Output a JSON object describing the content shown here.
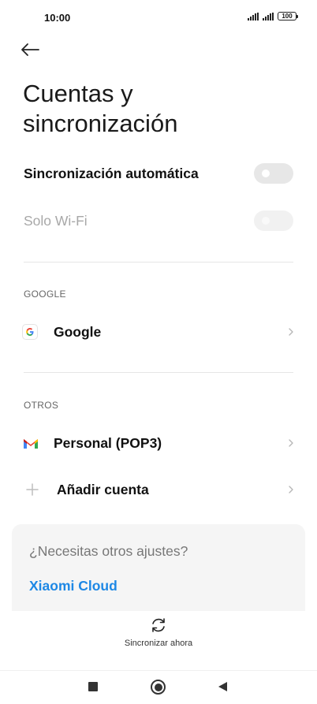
{
  "status_bar": {
    "time": "10:00",
    "battery": "100",
    "icons": [
      "signal-icon",
      "signal-icon",
      "battery-icon"
    ]
  },
  "header": {
    "back_icon": "arrow-left-icon",
    "title": "Cuentas y sincronización"
  },
  "settings": {
    "auto_sync": {
      "label": "Sincronización automática",
      "enabled": false
    },
    "wifi_only": {
      "label": "Solo Wi-Fi",
      "enabled": false,
      "disabled": true
    }
  },
  "sections": {
    "google": {
      "header": "GOOGLE",
      "accounts": [
        {
          "label": "Google",
          "icon": "google-icon"
        }
      ]
    },
    "others": {
      "header": "OTROS",
      "accounts": [
        {
          "label": "Personal (POP3)",
          "icon": "gmail-icon"
        }
      ],
      "add_account": {
        "label": "Añadir cuenta",
        "icon": "plus-icon"
      }
    }
  },
  "card": {
    "question": "¿Necesitas otros ajustes?",
    "link": "Xiaomi Cloud"
  },
  "sync_now": {
    "label": "Sincronizar ahora",
    "icon": "sync-icon"
  },
  "nav_bar": {
    "icons": [
      "recents-square-icon",
      "home-circle-icon",
      "back-triangle-icon"
    ]
  },
  "colors": {
    "accent": "#1e88e5",
    "toggle_off": "#e7e7e7",
    "card_bg": "#f5f5f5"
  }
}
